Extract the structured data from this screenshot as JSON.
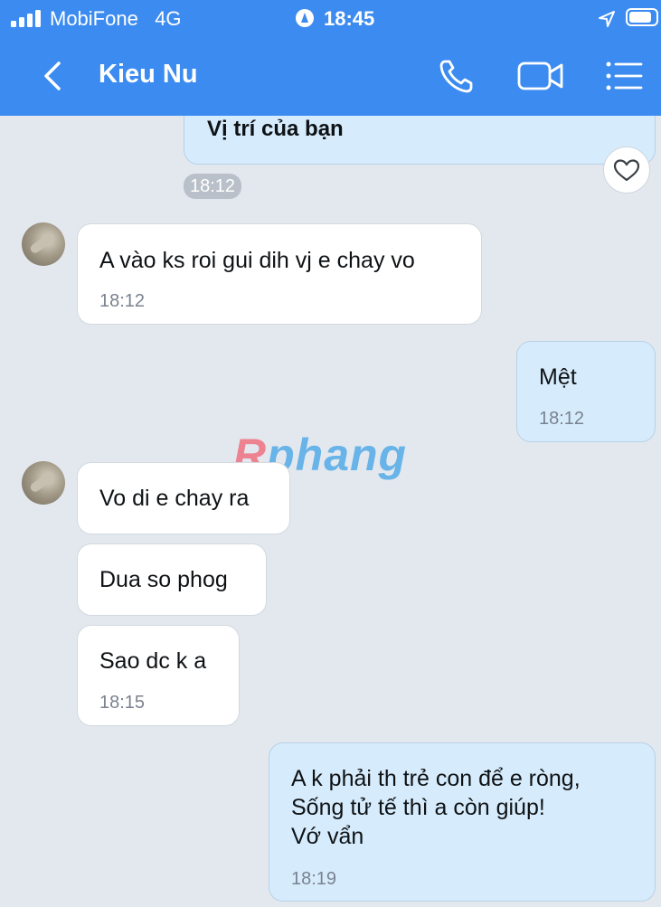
{
  "status_bar": {
    "carrier": "MobiFone",
    "network": "4G",
    "time": "18:45",
    "icons": [
      "signal-icon",
      "location-active-icon",
      "gps-arrow-icon",
      "battery-icon"
    ]
  },
  "header": {
    "contact_name": "Kieu Nu",
    "icons": [
      "back-chevron-icon",
      "phone-icon",
      "video-call-icon",
      "menu-list-icon"
    ]
  },
  "messages": {
    "location": {
      "text": "Vị trí của bạn",
      "time": "18:12"
    },
    "m1": {
      "text": "A vào ks roi gui dih vj e chay vo",
      "time": "18:12"
    },
    "m2": {
      "text": "Mệt",
      "time": "18:12"
    },
    "m3": {
      "text": "Vo di e chay ra"
    },
    "m4": {
      "text": "Dua so phog"
    },
    "m5": {
      "text": "Sao dc k a",
      "time": "18:15"
    },
    "m6": {
      "line1": "A k phải th trẻ con để e ròng,",
      "line2": "Sống tử tế thì a còn giúp!",
      "line3": "Vớ vẩn",
      "time": "18:19"
    }
  },
  "watermark": {
    "first": "R",
    "rest": "phang"
  },
  "colors": {
    "header_blue": "#3c8bf0",
    "outgoing_bubble": "#d6ecfc",
    "incoming_bubble": "#ffffff",
    "background": "#e3e8ef"
  }
}
